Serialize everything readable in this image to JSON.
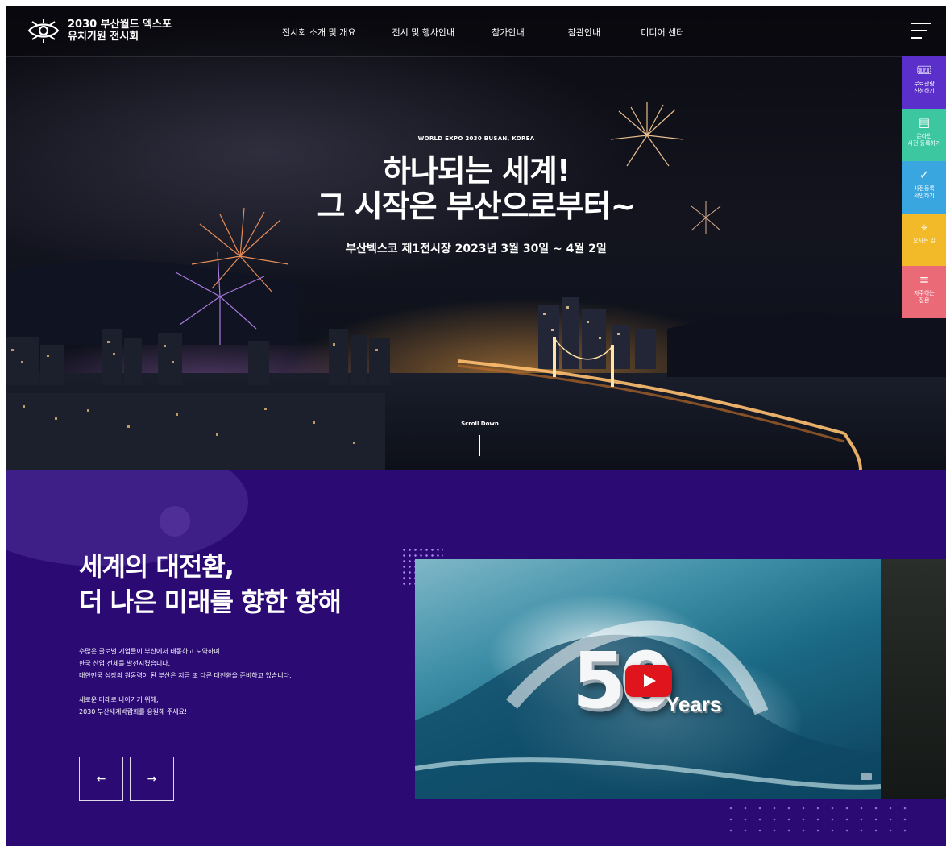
{
  "header": {
    "logo_line1": "2030 부산월드 엑스포",
    "logo_line2": "유치기원 전시회",
    "nav": [
      "전시회 소개 및 개요",
      "전시 및 행사안내",
      "참가안내",
      "참관안내",
      "미디어 센터"
    ]
  },
  "hero": {
    "eyebrow": "WORLD EXPO 2030 BUSAN, KOREA",
    "headline_line1": "하나되는 세계!",
    "headline_line2": "그 시작은 부산으로부터~",
    "subline": "부산벡스코 제1전시장 2023년 3월 30일 ~ 4월 2일",
    "scroll_label": "Scroll Down"
  },
  "quick_menu": [
    {
      "label": "무료관람\n신청하기",
      "icon": "ticket-icon",
      "color": "#5b2fc9"
    },
    {
      "label": "온라인\n사전 등록하기",
      "icon": "document-icon",
      "color": "#3cc7a0"
    },
    {
      "label": "사전등록\n확인하기",
      "icon": "check-circle-icon",
      "color": "#3aa6e0"
    },
    {
      "label": "오시는 길",
      "icon": "location-pin-icon",
      "color": "#f2b928"
    },
    {
      "label": "자주하는\n질문",
      "icon": "faq-search-icon",
      "color": "#ea6a78"
    }
  ],
  "promo": {
    "title_line1": "세계의 대전환,",
    "title_line2": "더 나은 미래를 향한 항해",
    "text_lines": [
      "수많은 글로벌 기업들이 부산에서 태동하고 도약하며",
      "한국 산업 전체를 발전시켰습니다.",
      "대한민국 성장의 원동력이 된 부산은 지금 또 다른 대전환을 준비하고 있습니다."
    ],
    "text_lines2": [
      "새로운 미래로 나아가기 위해,",
      "2030 부산세계박람회를 응원해 주세요!"
    ],
    "prev_arrow": "←",
    "next_arrow": "→",
    "video_number": "50",
    "video_word": "Years"
  },
  "colors": {
    "promo_bg": "#2b0a74",
    "youtube_red": "#e0141c"
  }
}
